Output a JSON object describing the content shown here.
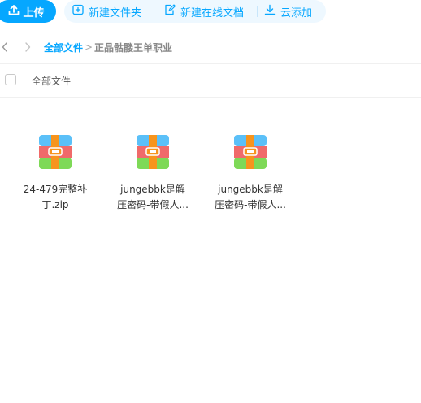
{
  "toolbar": {
    "upload_label": "上传",
    "new_folder_label": "新建文件夹",
    "new_doc_label": "新建在线文档",
    "cloud_add_label": "云添加"
  },
  "breadcrumb": {
    "root": "全部文件",
    "separator": ">",
    "current": "正品骷髅王单职业"
  },
  "list_header": {
    "label": "全部文件"
  },
  "files": [
    {
      "line1": "24-479完整补",
      "line2": "丁.zip",
      "icon": "zip-archive-icon"
    },
    {
      "line1": "jungebbk是解",
      "line2": "压密码-带假人...",
      "icon": "zip-archive-icon"
    },
    {
      "line1": "jungebbk是解",
      "line2": "压密码-带假人...",
      "icon": "zip-archive-icon"
    }
  ],
  "colors": {
    "accent": "#06a7ff",
    "accent_light": "#eef8ff",
    "zip_top": "#5bc0f8",
    "zip_mid": "#f06a6a",
    "zip_bottom": "#7ed957",
    "zip_band": "#f7941d"
  }
}
